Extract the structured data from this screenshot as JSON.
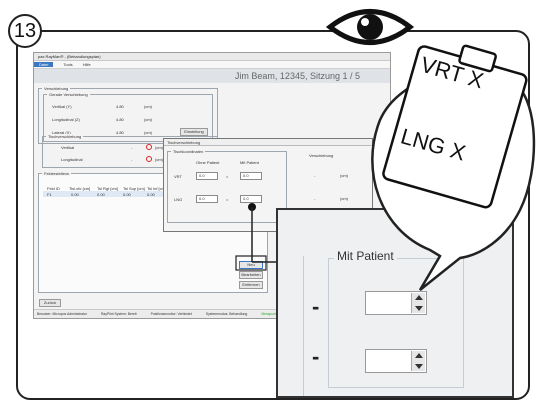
{
  "step": "13",
  "window": {
    "title": "pax RayMan® - (Behandlungsplan)",
    "menu": [
      "Datei",
      "Tools",
      "Hilfe"
    ],
    "banner": "Jim Beam, 12345, Sitzung 1 / 5"
  },
  "verschiebung": {
    "group_title": "Verschiebung",
    "sub_title": "Gerade Verschiebung",
    "rows": [
      {
        "label": "Vertikal (Y)",
        "value": "4.80",
        "unit": "(cm)"
      },
      {
        "label": "Longitudinal (Z)",
        "value": "4.80",
        "unit": "(cm)"
      },
      {
        "label": "Lateral (X)",
        "value": "4.80",
        "unit": "(cm)"
      }
    ],
    "einstellung_button": "Einstellung",
    "tisch_title": "Tischverschiebung",
    "tisch_rows": [
      "Vertikal",
      "Longitudinal"
    ],
    "tisch_dash": "-"
  },
  "felder": {
    "group_title": "Felderstellenn",
    "columns": [
      "Feld ID",
      "Tisl.ofc [cm]",
      "Tsl Rgt [cm]",
      "Tsl Sup [cm]",
      "Tsl Inf [cm]"
    ],
    "row": [
      "F1",
      "0.00",
      "0.00",
      "0.00",
      "0.00"
    ]
  },
  "side_buttons": [
    "Neu",
    "Bearbeiten",
    "Entfernen"
  ],
  "zuruck_button": "Zurück",
  "status": [
    "Benutzer: Micropos Administrator",
    "RayPilot System: Bereit",
    "Positionsmonitor: Verbindet",
    "Systemmodus: Behandlung",
    "Messpunkt"
  ],
  "dialog": {
    "title": "Tischverschiebung",
    "sub_title": "Tischkoordinaten",
    "col_ohne": "Ohne Patient",
    "col_mit": "Mit Patient",
    "verschiebung": "Verschiebung",
    "rows": [
      {
        "label": "VRT",
        "ohne": "0.0",
        "eq": "=",
        "mit": "0.0",
        "dash": "-",
        "unit": "(cm)"
      },
      {
        "label": "LNG",
        "ohne": "0.0",
        "eq": "=",
        "mit": "0.0",
        "dash": "-",
        "unit": "(cm)"
      }
    ]
  },
  "zoom": {
    "group_title": "Mit Patient",
    "dash": "-"
  },
  "note": {
    "line1": "VRT X",
    "line2": "LNG X"
  },
  "colors": {
    "accent": "#3a78c2",
    "error": "#d22222",
    "outline": "#222222"
  }
}
